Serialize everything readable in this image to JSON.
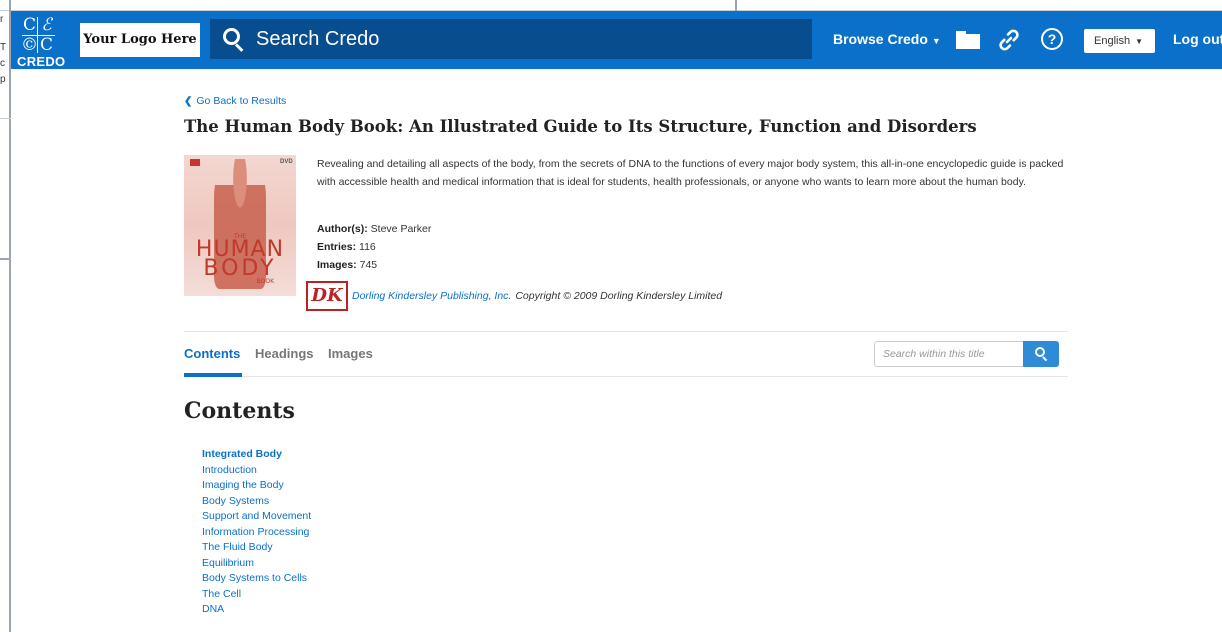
{
  "background": {
    "fragments": [
      "r",
      "T",
      "c",
      "p"
    ]
  },
  "header": {
    "brand_word": "CREDO",
    "brand_glyphs": [
      "C",
      "ℰ",
      "©",
      "C"
    ],
    "your_logo": "Your Logo Here",
    "search_placeholder": "Search Credo",
    "browse_label": "Browse Credo",
    "language": "English",
    "logout": "Log out",
    "accent_color": "#0a70c9"
  },
  "book": {
    "back_link": "Go Back to Results",
    "title": "The Human Body Book: An Illustrated Guide to Its Structure, Function and Disorders",
    "cover": {
      "the": "THE",
      "line1": "HUMAN",
      "line2": "BODY",
      "book": "BOOK"
    },
    "description": "Revealing and detailing all aspects of the body, from the secrets of DNA to the functions of every major body system, this all-in-one encyclopedic guide is packed with accessible health and medical information that is ideal for students, health professionals, or anyone who wants to learn more about the human body.",
    "meta": {
      "author_label": "Author(s):",
      "author": "Steve Parker",
      "entries_label": "Entries:",
      "entries": "116",
      "images_label": "Images:",
      "images": "745"
    },
    "publisher": {
      "logo_text": "DK",
      "name": "Dorling Kindersley Publishing, Inc.",
      "copyright": "Copyright © 2009 Dorling Kindersley Limited"
    }
  },
  "tabs": {
    "items": [
      "Contents",
      "Headings",
      "Images"
    ],
    "active": "Contents",
    "search_placeholder": "Search within this title"
  },
  "contents": {
    "heading": "Contents",
    "items": [
      "Integrated Body",
      "Introduction",
      "Imaging the Body",
      "Body Systems",
      "Support and Movement",
      "Information Processing",
      "The Fluid Body",
      "Equilibrium",
      "Body Systems to Cells",
      "The Cell",
      "DNA"
    ]
  }
}
